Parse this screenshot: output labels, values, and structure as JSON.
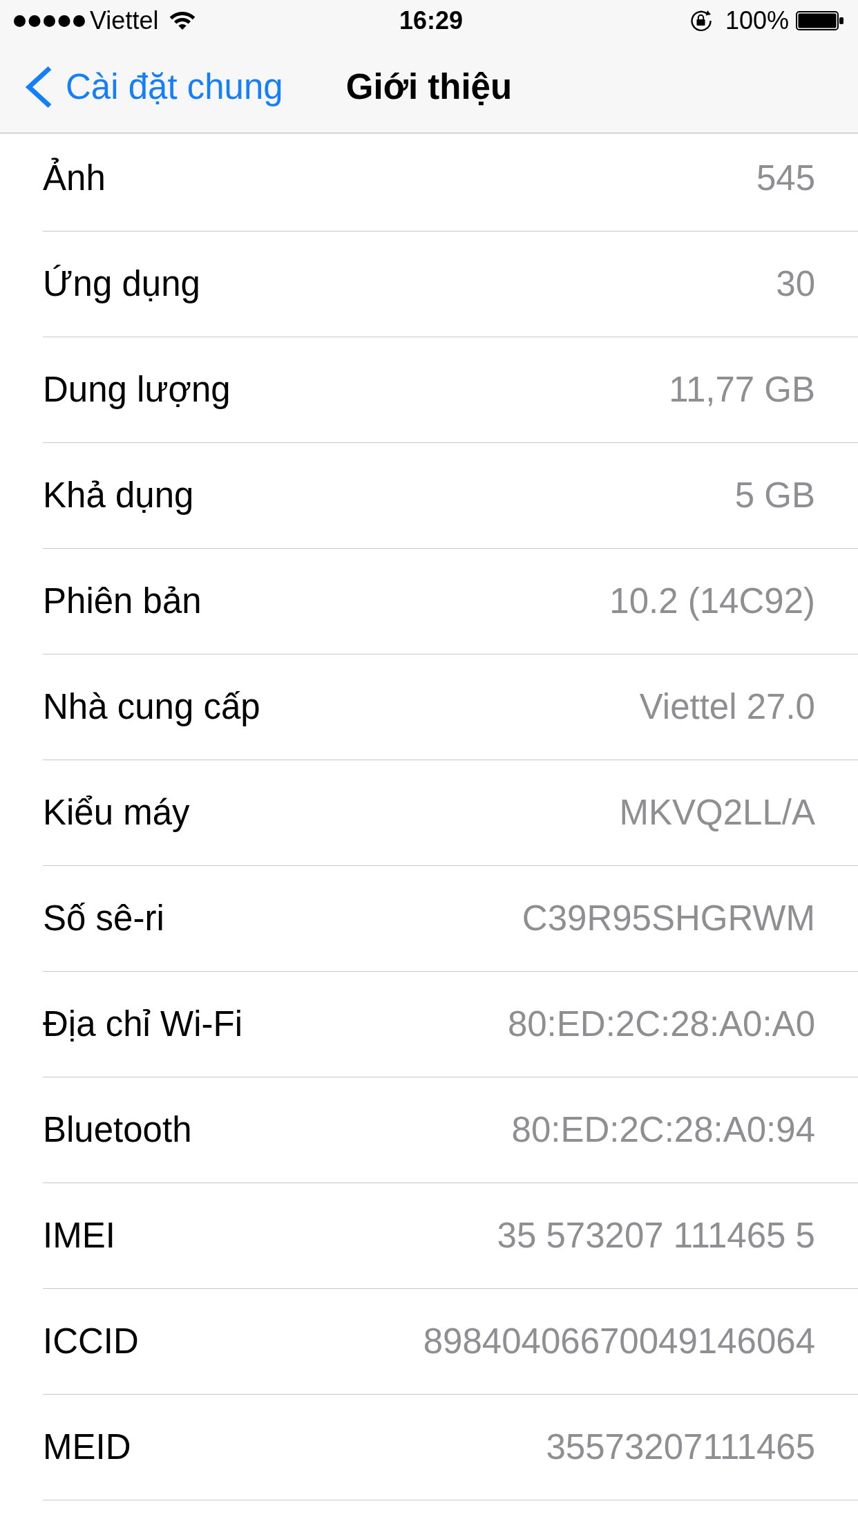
{
  "status_bar": {
    "carrier": "Viettel",
    "time": "16:29",
    "battery": "100%"
  },
  "nav_bar": {
    "back_label": "Cài đặt chung",
    "title": "Giới thiệu"
  },
  "rows": [
    {
      "label": "Ảnh",
      "value": "545"
    },
    {
      "label": "Ứng dụng",
      "value": "30"
    },
    {
      "label": "Dung lượng",
      "value": "11,77 GB"
    },
    {
      "label": "Khả dụng",
      "value": "5 GB"
    },
    {
      "label": "Phiên bản",
      "value": "10.2 (14C92)"
    },
    {
      "label": "Nhà cung cấp",
      "value": "Viettel 27.0"
    },
    {
      "label": "Kiểu máy",
      "value": "MKVQ2LL/A"
    },
    {
      "label": "Số sê-ri",
      "value": "C39R95SHGRWM"
    },
    {
      "label": "Địa chỉ Wi-Fi",
      "value": "80:ED:2C:28:A0:A0"
    },
    {
      "label": "Bluetooth",
      "value": "80:ED:2C:28:A0:94"
    },
    {
      "label": "IMEI",
      "value": "35 573207 111465 5"
    },
    {
      "label": "ICCID",
      "value": "89840406670049146064"
    },
    {
      "label": "MEID",
      "value": "35573207111465"
    }
  ]
}
